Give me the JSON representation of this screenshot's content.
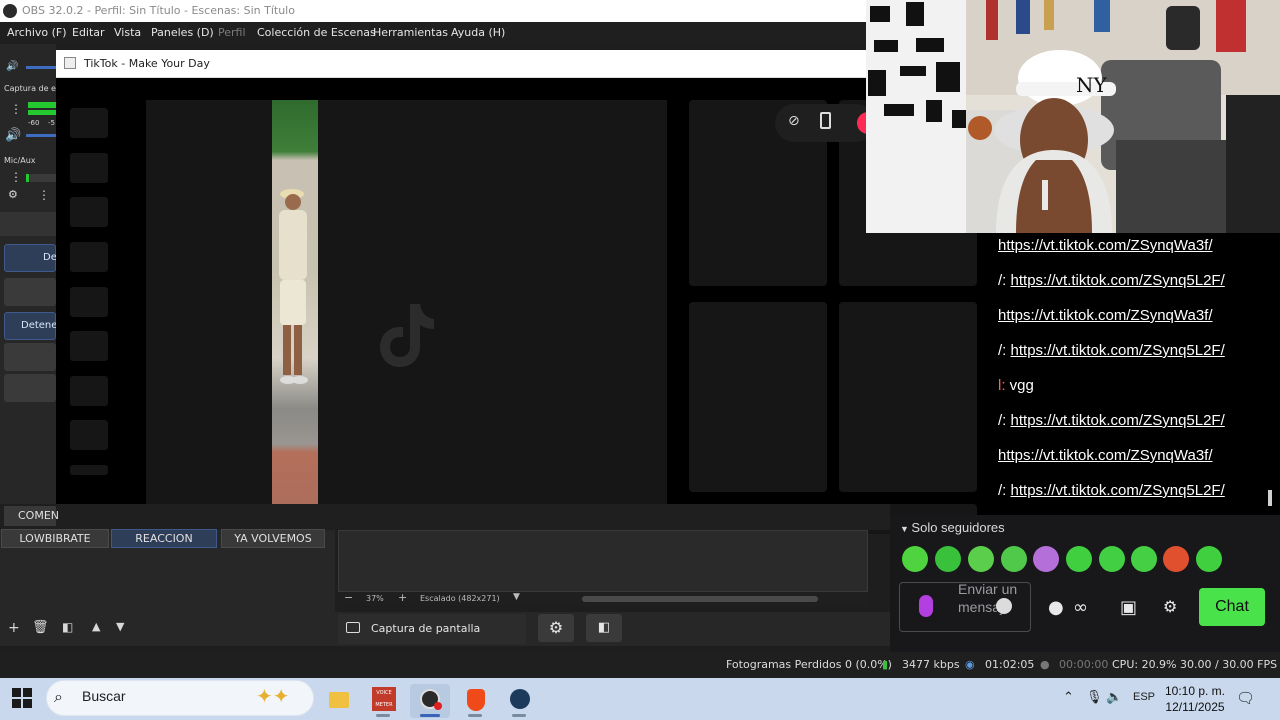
{
  "obs": {
    "title": "OBS 32.0.2 - Perfil: Sin Título - Escenas: Sin Título",
    "menu": [
      "Archivo (F)",
      "Editar",
      "Vista",
      "Paneles (D)",
      "Perfil",
      "Colección de Escenas",
      "Herramientas",
      "Ayuda (H)"
    ],
    "audio": {
      "capture_label": "Captura de e",
      "mic_label": "Mic/Aux",
      "meter_ticks": [
        "-60",
        "-5"
      ]
    },
    "controls": {
      "start_label": "De",
      "stop_label": "Detene",
      "comment_label": "COMEN"
    },
    "scenes": [
      "LOWBIBRATE",
      "REACCION",
      "YA VOLVEMOS"
    ],
    "active_scene": "REACCION",
    "zoom": {
      "minus": "−",
      "value": "37%",
      "plus": "+",
      "scale": "Escalado (482x271)"
    },
    "source": {
      "label": "Captura de pantalla"
    },
    "status": {
      "dropped": "Fotogramas Perdidos 0 (0.0%)",
      "bitrate": "3477 kbps",
      "stream_time": "01:02:05",
      "record_time": "00:00:00",
      "cpu": "CPU: 20.9%",
      "fps": "30.00 / 30.00 FPS"
    }
  },
  "tiktok": {
    "window_title": "TikTok - Make Your Day"
  },
  "chat": {
    "messages": [
      {
        "prefix": "",
        "text": "https://vt.tiktok.com/ZSynqWa3f/",
        "link": true
      },
      {
        "prefix": "/: ",
        "text": "https://vt.tiktok.com/ZSynq5L2F/",
        "link": true
      },
      {
        "prefix": "",
        "text": "https://vt.tiktok.com/ZSynqWa3f/",
        "link": true
      },
      {
        "prefix": "/: ",
        "text": "https://vt.tiktok.com/ZSynq5L2F/",
        "link": true
      },
      {
        "prefix": "l: ",
        "text": "vgg",
        "link": false
      },
      {
        "prefix": "/: ",
        "text": "https://vt.tiktok.com/ZSynq5L2F/",
        "link": true
      },
      {
        "prefix": "",
        "text": "https://vt.tiktok.com/ZSynqWa3f/",
        "link": true
      },
      {
        "prefix": "/: ",
        "text": "https://vt.tiktok.com/ZSynq5L2F/",
        "link": true
      }
    ],
    "followers_only": "Solo seguidores",
    "input_placeholder": "Enviar un mensaje",
    "send_button": "Chat",
    "emote_colors": [
      "#4fd33e",
      "#39c13c",
      "#5bcf4b",
      "#50c84a",
      "#b46fd8",
      "#3fcf3f",
      "#43cf43",
      "#45cf45",
      "#e0502f",
      "#3fcf3f"
    ]
  },
  "taskbar": {
    "search_placeholder": "Buscar",
    "language": "ESP",
    "time": "10:10 p. m.",
    "date": "12/11/2025",
    "voicemeeter_label": "VOICE METER"
  }
}
